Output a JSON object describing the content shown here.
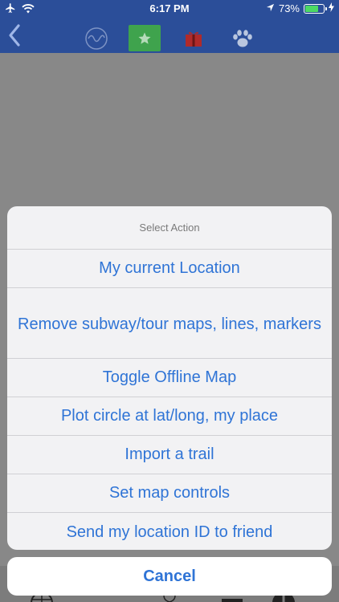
{
  "status_bar": {
    "time": "6:17 PM",
    "battery_percent": "73%",
    "battery_level": 0.73,
    "icons": [
      "airplane-icon",
      "wifi-icon",
      "location-arrow-icon",
      "battery-icon",
      "charging-bolt-icon"
    ]
  },
  "nav_bar": {
    "icons": [
      "back-chevron-icon",
      "wave-icon",
      "star-icon",
      "gift-icon",
      "paw-icon"
    ],
    "active_tab_color": "#3fa34d",
    "bar_color": "#2b4e99"
  },
  "action_sheet": {
    "title": "Select Action",
    "items": [
      "My current Location",
      "Remove subway/tour maps, lines, markers",
      "Toggle Offline Map",
      "Plot circle at lat/long, my place",
      "Import a trail",
      "Set map controls",
      "Send my location ID to friend"
    ],
    "cancel_label": "Cancel",
    "accent_color": "#2f74d6"
  }
}
